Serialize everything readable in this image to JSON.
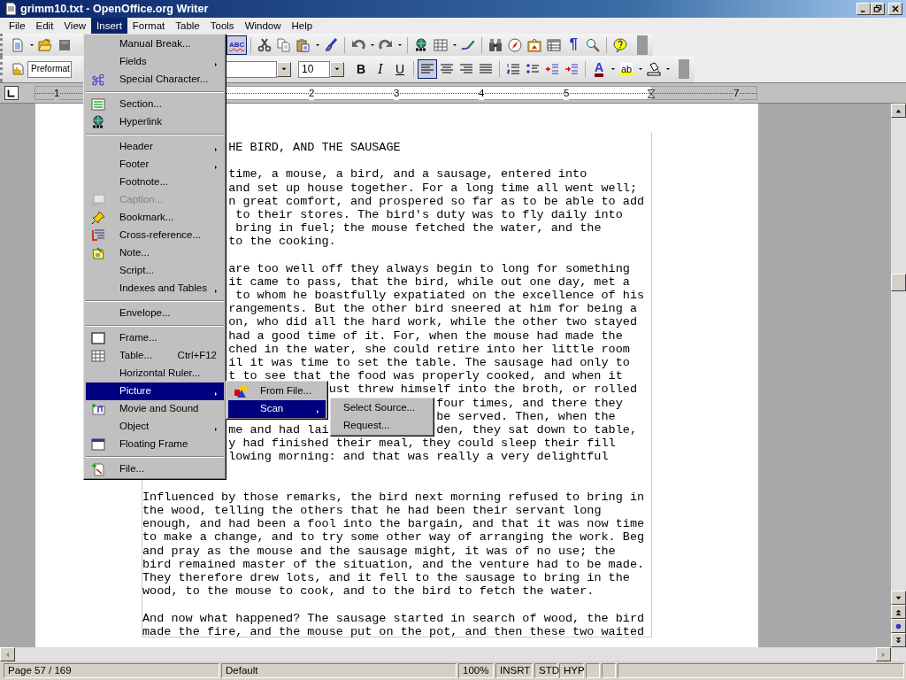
{
  "window": {
    "title": "grimm10.txt - OpenOffice.org Writer"
  },
  "menubar": [
    {
      "label": "File",
      "selected": false
    },
    {
      "label": "Edit",
      "selected": false
    },
    {
      "label": "View",
      "selected": false
    },
    {
      "label": "Insert",
      "selected": true
    },
    {
      "label": "Format",
      "selected": false
    },
    {
      "label": "Table",
      "selected": false
    },
    {
      "label": "Tools",
      "selected": false
    },
    {
      "label": "Window",
      "selected": false
    },
    {
      "label": "Help",
      "selected": false
    }
  ],
  "toolbar_1": {
    "left_items": [
      {
        "kind": "new",
        "pressed": false,
        "dropdown": true
      },
      {
        "kind": "open",
        "pressed": false
      },
      {
        "kind": "save",
        "pressed": false
      }
    ],
    "right_items": [
      {
        "kind": "spell",
        "label": "ABC",
        "pressed": true
      },
      {
        "kind": "separator"
      },
      {
        "kind": "cut",
        "pressed": false
      },
      {
        "kind": "copy",
        "pressed": false
      },
      {
        "kind": "paste",
        "pressed": false,
        "dropdown": true
      },
      {
        "kind": "brush",
        "pressed": false
      },
      {
        "kind": "separator"
      },
      {
        "kind": "undo",
        "pressed": false,
        "dropdown": true
      },
      {
        "kind": "redo",
        "pressed": false,
        "dropdown": true
      },
      {
        "kind": "separator"
      },
      {
        "kind": "globe",
        "pressed": false
      },
      {
        "kind": "table",
        "pressed": false,
        "dropdown": true
      },
      {
        "kind": "pen",
        "pressed": false
      },
      {
        "kind": "separator"
      },
      {
        "kind": "find",
        "pressed": false
      },
      {
        "kind": "compass",
        "pressed": false
      },
      {
        "kind": "gallery",
        "pressed": false
      },
      {
        "kind": "grid",
        "pressed": false
      },
      {
        "kind": "pilcrow",
        "label": "¶",
        "pressed": false
      },
      {
        "kind": "zoom",
        "pressed": false
      },
      {
        "kind": "separator"
      },
      {
        "kind": "help",
        "pressed": false
      },
      {
        "kind": "overflow"
      }
    ]
  },
  "toolbar_2": {
    "left_items": [
      {
        "kind": "hand",
        "pressed": false
      },
      {
        "kind": "style_field",
        "value": "Preformat"
      }
    ],
    "right_items": [
      {
        "kind": "font_field"
      },
      {
        "kind": "size_field",
        "value": "10"
      },
      {
        "kind": "bold",
        "label": "B",
        "pressed": false
      },
      {
        "kind": "italic",
        "label": "I",
        "pressed": false
      },
      {
        "kind": "underline",
        "label": "U",
        "pressed": false
      },
      {
        "kind": "separator"
      },
      {
        "kind": "alignl",
        "pressed": true
      },
      {
        "kind": "alignc",
        "pressed": false
      },
      {
        "kind": "alignr",
        "pressed": false
      },
      {
        "kind": "justify",
        "pressed": false
      },
      {
        "kind": "separator"
      },
      {
        "kind": "numbering",
        "pressed": false
      },
      {
        "kind": "bullets",
        "pressed": false
      },
      {
        "kind": "outdent",
        "pressed": false
      },
      {
        "kind": "indent",
        "pressed": false
      },
      {
        "kind": "separator"
      },
      {
        "kind": "fontcolor",
        "label": "A",
        "pressed": false,
        "dropdown": true
      },
      {
        "kind": "highlight",
        "label": "ab",
        "pressed": false,
        "dropdown": true
      },
      {
        "kind": "bgcolor",
        "pressed": false,
        "dropdown": true
      },
      {
        "kind": "overflow"
      }
    ]
  },
  "ruler": {
    "numbers": [
      "1",
      "2",
      "3",
      "4",
      "5",
      "7"
    ]
  },
  "document": {
    "paragraphs": [
      [
        [
          "HE BIRD, AND THE SAUSAGE"
        ]
      ],
      [
        [
          "time, a mouse, a bird, and a sausage, entered into"
        ],
        [
          "and set up house together. For a long time all went well;"
        ],
        [
          "n great comfort, and prospered so far as to be able to add"
        ],
        [
          "to their stores. The bird's duty was to fly daily into"
        ],
        [
          "bring in fuel; the mouse fetched the water, and the"
        ],
        [
          "to the cooking."
        ]
      ],
      [
        [
          "are too well off they always begin to long for something"
        ],
        [
          "it came to pass, that the bird, while out one day, met a"
        ],
        [
          "to whom he boastfully expatiated on the excellence of his"
        ],
        [
          "rangements. But the other bird sneered at him for being a"
        ],
        [
          "on, who did all the hard work, while the other two stayed"
        ],
        [
          "had a good time of it. For, when the mouse had made the"
        ],
        [
          "ched in the water, she could retire into her little room"
        ],
        [
          "il it was time to set the table. The sausage had only to"
        ],
        [
          "t to see that the food was properly cooked, and when it"
        ],
        [
          "ust threw himself into the broth, or rolled"
        ],
        [
          "four times, and there they"
        ],
        [
          "be served. Then, when the"
        ],
        [
          "me and had lai",
          "den, they sat down to table,"
        ],
        [
          "y had finished their meal, they could sleep their fill"
        ],
        [
          "lowing morning: and that was really a very delightful"
        ]
      ],
      [
        [
          "Influenced by those remarks, the bird next morning refused to bring in"
        ],
        [
          "the wood, telling the others that he had been their servant long"
        ],
        [
          "enough, and had been a fool into the bargain, and that it was now time"
        ],
        [
          "to make a change, and to try some other way of arranging the work. Beg"
        ],
        [
          "and pray as the mouse and the sausage might, it was of no use; the"
        ],
        [
          "bird remained master of the situation, and the venture had to be made."
        ],
        [
          "They therefore drew lots, and it fell to the sausage to bring in the"
        ],
        [
          "wood, to the mouse to cook, and to the bird to fetch the water."
        ]
      ],
      [
        [
          "And now what happened? The sausage started in search of wood, the bird"
        ],
        [
          "made the fire, and the mouse put on the pot, and then these two waited"
        ]
      ]
    ]
  },
  "insert_menu": [
    {
      "kind": "item",
      "label": "Manual Break...",
      "selected": false,
      "disabled": false,
      "submenu": false
    },
    {
      "kind": "item",
      "label": "Fields",
      "selected": false,
      "disabled": false,
      "submenu": true
    },
    {
      "kind": "item",
      "label": "Special Character...",
      "selected": false,
      "disabled": false,
      "submenu": false
    },
    {
      "kind": "separator"
    },
    {
      "kind": "item",
      "label": "Section...",
      "selected": false,
      "disabled": false,
      "submenu": false
    },
    {
      "kind": "item",
      "label": "Hyperlink",
      "selected": false,
      "disabled": false,
      "submenu": false
    },
    {
      "kind": "separator"
    },
    {
      "kind": "item",
      "label": "Header",
      "selected": false,
      "disabled": false,
      "submenu": true
    },
    {
      "kind": "item",
      "label": "Footer",
      "selected": false,
      "disabled": false,
      "submenu": true
    },
    {
      "kind": "item",
      "label": "Footnote...",
      "selected": false,
      "disabled": false,
      "submenu": false
    },
    {
      "kind": "item",
      "label": "Caption...",
      "selected": false,
      "disabled": true,
      "submenu": false
    },
    {
      "kind": "item",
      "label": "Bookmark...",
      "selected": false,
      "disabled": false,
      "submenu": false
    },
    {
      "kind": "item",
      "label": "Cross-reference...",
      "selected": false,
      "disabled": false,
      "submenu": false
    },
    {
      "kind": "item",
      "label": "Note...",
      "selected": false,
      "disabled": false,
      "submenu": false
    },
    {
      "kind": "item",
      "label": "Script...",
      "selected": false,
      "disabled": false,
      "submenu": false
    },
    {
      "kind": "item",
      "label": "Indexes and Tables",
      "selected": false,
      "disabled": false,
      "submenu": true
    },
    {
      "kind": "separator"
    },
    {
      "kind": "item",
      "label": "Envelope...",
      "selected": false,
      "disabled": false,
      "submenu": false
    },
    {
      "kind": "separator"
    },
    {
      "kind": "item",
      "label": "Frame...",
      "selected": false,
      "disabled": false,
      "submenu": false
    },
    {
      "kind": "item",
      "label": "Table...",
      "shortcut": "Ctrl+F12",
      "selected": false,
      "disabled": false,
      "submenu": false
    },
    {
      "kind": "item",
      "label": "Horizontal Ruler...",
      "selected": false,
      "disabled": false,
      "submenu": false
    },
    {
      "kind": "item",
      "label": "Picture",
      "selected": true,
      "disabled": false,
      "submenu": true
    },
    {
      "kind": "item",
      "label": "Movie and Sound",
      "selected": false,
      "disabled": false,
      "submenu": false
    },
    {
      "kind": "item",
      "label": "Object",
      "selected": false,
      "disabled": false,
      "submenu": true
    },
    {
      "kind": "item",
      "label": "Floating Frame",
      "selected": false,
      "disabled": false,
      "submenu": false
    },
    {
      "kind": "separator"
    },
    {
      "kind": "item",
      "label": "File...",
      "selected": false,
      "disabled": false,
      "submenu": false
    }
  ],
  "picture_submenu": [
    {
      "kind": "item",
      "label": "From File...",
      "selected": false,
      "disabled": false,
      "submenu": false
    },
    {
      "kind": "item",
      "label": "Scan",
      "selected": true,
      "disabled": false,
      "submenu": true
    }
  ],
  "scan_submenu": [
    {
      "kind": "item",
      "label": "Select Source...",
      "selected": false,
      "disabled": false,
      "submenu": false
    },
    {
      "kind": "item",
      "label": "Request...",
      "selected": false,
      "disabled": false,
      "submenu": false
    }
  ],
  "status_bar": {
    "fields": [
      "Page 57 / 169",
      "Default",
      "100%",
      "INSRT",
      "STD",
      "HYP"
    ]
  }
}
